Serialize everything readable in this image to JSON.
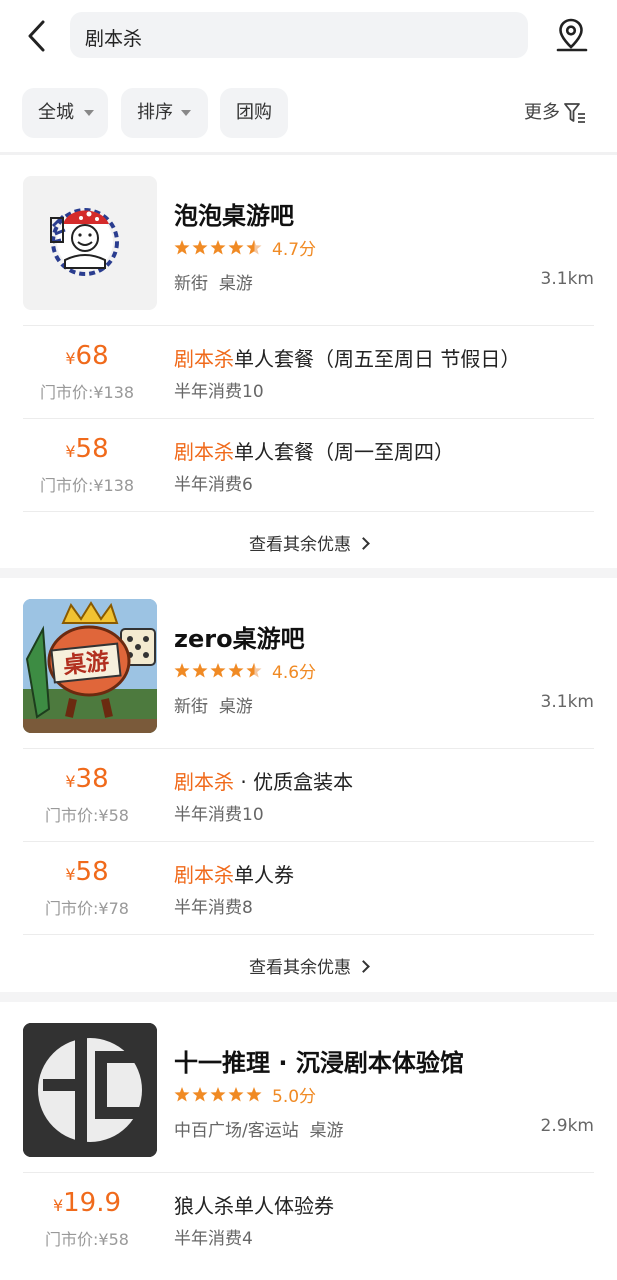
{
  "header": {
    "search_query": "剧本杀"
  },
  "filters": {
    "city": "全城",
    "sort": "排序",
    "group": "团购",
    "more": "更多"
  },
  "shops": [
    {
      "name": "泡泡桌游吧",
      "rating": "4.7分",
      "area": "新街",
      "category": "桌游",
      "distance": "3.1km",
      "deals": [
        {
          "price_symbol": "¥",
          "price": "68",
          "orig": "门市价:¥138",
          "highlight": "剧本杀",
          "rest": "单人套餐（周五至周日 节假日）",
          "sold": "半年消费10"
        },
        {
          "price_symbol": "¥",
          "price": "58",
          "orig": "门市价:¥138",
          "highlight": "剧本杀",
          "rest": "单人套餐（周一至周四）",
          "sold": "半年消费6"
        }
      ],
      "see_more": "查看其余优惠"
    },
    {
      "name": "zero桌游吧",
      "rating": "4.6分",
      "area": "新街",
      "category": "桌游",
      "distance": "3.1km",
      "thumb_text": "桌游",
      "deals": [
        {
          "price_symbol": "¥",
          "price": "38",
          "orig": "门市价:¥58",
          "highlight": "剧本杀",
          "rest": " · 优质盒装本",
          "sold": "半年消费10"
        },
        {
          "price_symbol": "¥",
          "price": "58",
          "orig": "门市价:¥78",
          "highlight": "剧本杀",
          "rest": "单人券",
          "sold": "半年消费8"
        }
      ],
      "see_more": "查看其余优惠"
    },
    {
      "name": "十一推理 · 沉浸剧本体验馆",
      "rating": "5.0分",
      "area": "中百广场/客运站",
      "category": "桌游",
      "distance": "2.9km",
      "deals": [
        {
          "price_symbol": "¥",
          "price": "19.9",
          "orig": "门市价:¥58",
          "highlight": "",
          "rest": "狼人杀单人体验券",
          "sold": "半年消费4"
        }
      ]
    }
  ],
  "colors": {
    "accent": "#f06a1b",
    "star": "#f08a24"
  }
}
